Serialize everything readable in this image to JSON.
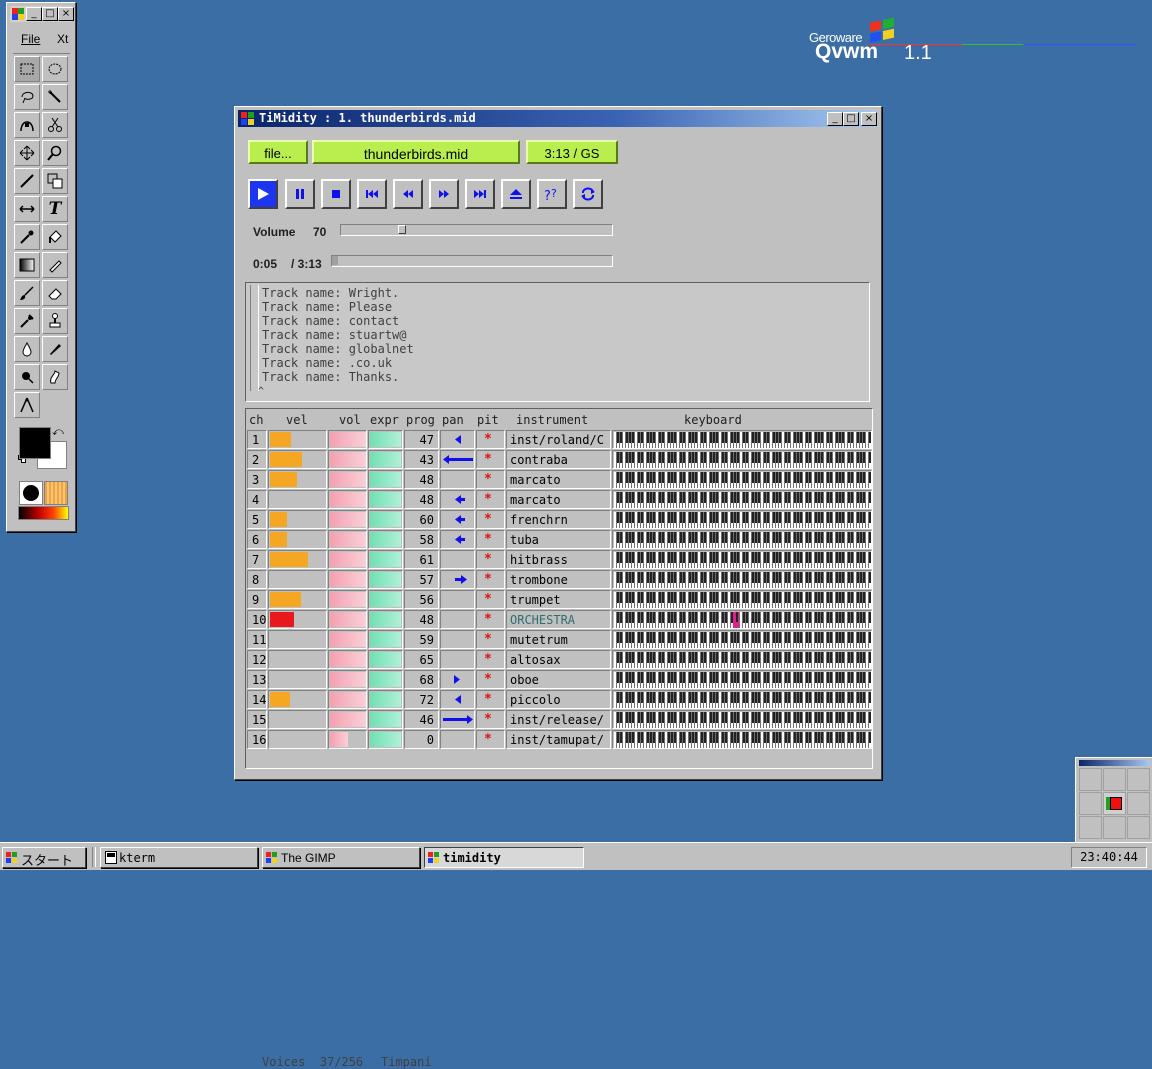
{
  "desktop": {
    "brand_company": "Geroware",
    "brand_product": "Qvwm",
    "brand_version": "1.1"
  },
  "gimp": {
    "menu": [
      "File",
      "Xt"
    ],
    "tools": [
      "rect-select",
      "ellipse-select",
      "free-select",
      "fuzzy-select",
      "bezier-select",
      "scissors",
      "move",
      "magnify",
      "crop",
      "transform",
      "flip",
      "text",
      "color-picker",
      "bucket-fill",
      "blend",
      "pencil",
      "paintbrush",
      "eraser",
      "airbrush",
      "clone",
      "convolve",
      "ink",
      "dodge-burn",
      "smudge",
      "measure"
    ],
    "text_tool_glyph": "T"
  },
  "timidity": {
    "title": "TiMidity : 1. thunderbirds.mid",
    "file_button": "file...",
    "filename": "thunderbirds.mid",
    "time_mode": "3:13 / GS",
    "controls": [
      "play",
      "pause",
      "stop",
      "first",
      "rewind",
      "forward",
      "last",
      "eject",
      "help",
      "repeat"
    ],
    "volume_label": "Volume",
    "volume_value": "70",
    "volume_level": 0.13,
    "time_current": "0:05",
    "time_total": "/ 3:13",
    "progress": 0.02,
    "console_lines": [
      "Track name: Wright.",
      "Track name: Please",
      "Track name: contact",
      "Track name: stuartw@",
      "Track name: globalnet",
      "Track name: .co.uk",
      "Track name: Thanks."
    ],
    "console_cursor": "^",
    "headers": {
      "ch": "ch",
      "vel": "vel",
      "vol": "vol",
      "expr": "expr",
      "prog": "prog",
      "pan": "pan",
      "pit": "pit",
      "instrument": "instrument",
      "keyboard": "keyboard"
    },
    "pitch_mark": "*",
    "channels": [
      {
        "ch": "1",
        "vel": 0.38,
        "prog": "47",
        "pan": "left-small",
        "instrument": "inst/roland/C"
      },
      {
        "ch": "2",
        "vel": 0.58,
        "prog": "43",
        "pan": "left-far",
        "instrument": "contraba"
      },
      {
        "ch": "3",
        "vel": 0.48,
        "prog": "48",
        "pan": "none",
        "instrument": "marcato"
      },
      {
        "ch": "4",
        "vel": 0.0,
        "prog": "48",
        "pan": "left-mid",
        "instrument": "marcato"
      },
      {
        "ch": "5",
        "vel": 0.3,
        "prog": "60",
        "pan": "left-mid",
        "instrument": "frenchrn"
      },
      {
        "ch": "6",
        "vel": 0.3,
        "prog": "58",
        "pan": "left-mid",
        "instrument": "tuba"
      },
      {
        "ch": "7",
        "vel": 0.68,
        "prog": "61",
        "pan": "none",
        "instrument": "hitbrass"
      },
      {
        "ch": "8",
        "vel": 0.0,
        "prog": "57",
        "pan": "right-mid",
        "instrument": "trombone"
      },
      {
        "ch": "9",
        "vel": 0.55,
        "prog": "56",
        "pan": "none",
        "instrument": "trumpet"
      },
      {
        "ch": "10",
        "vel": 0.42,
        "prog": "48",
        "pan": "none",
        "instrument": "ORCHESTRA",
        "drum": true
      },
      {
        "ch": "11",
        "vel": 0.0,
        "prog": "59",
        "pan": "none",
        "instrument": "mutetrum"
      },
      {
        "ch": "12",
        "vel": 0.0,
        "prog": "65",
        "pan": "none",
        "instrument": "altosax"
      },
      {
        "ch": "13",
        "vel": 0.0,
        "prog": "68",
        "pan": "right-small",
        "instrument": "oboe"
      },
      {
        "ch": "14",
        "vel": 0.35,
        "prog": "72",
        "pan": "left-small",
        "instrument": "piccolo"
      },
      {
        "ch": "15",
        "vel": 0.0,
        "prog": "46",
        "pan": "right-far",
        "instrument": "inst/release/"
      },
      {
        "ch": "16",
        "vel": 0.0,
        "prog": "0",
        "pan": "none",
        "instrument": "inst/tamupat/",
        "vol": 0.5
      }
    ],
    "voices_label": "Voices",
    "voices_value": "37/256",
    "status_instrument": "Timpani"
  },
  "taskbar": {
    "start": "スタート",
    "items": [
      {
        "label": "kterm",
        "active": false
      },
      {
        "label": "The GIMP",
        "active": false
      },
      {
        "label": "timidity",
        "active": true
      }
    ],
    "clock": "23:40:44"
  },
  "colors": {
    "desktop": "#3a6ea5",
    "lime": "#b8ef4e",
    "velocity": "#f5a623",
    "velocity_drum": "#e8181c",
    "drum_text": "#2f6f6f",
    "pan_arrow": "#1010ee",
    "pitch": "#e01010"
  }
}
